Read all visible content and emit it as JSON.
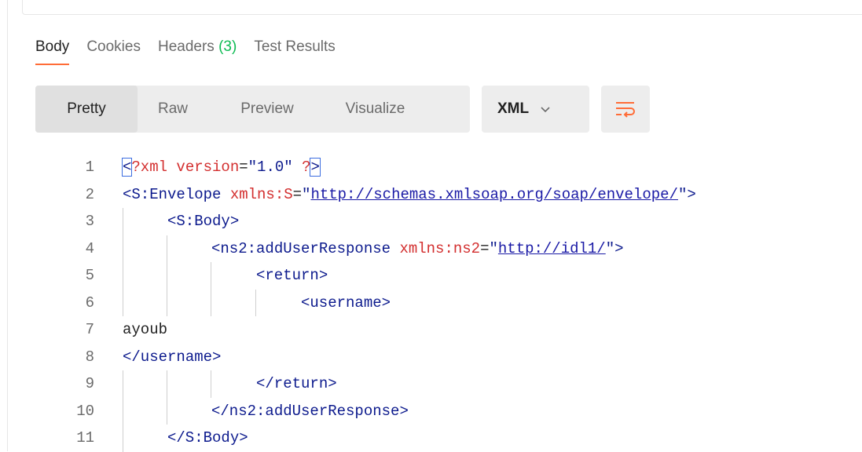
{
  "tabs": [
    {
      "label": "Body",
      "count": ""
    },
    {
      "label": "Cookies",
      "count": ""
    },
    {
      "label": "Headers",
      "count": "(3)"
    },
    {
      "label": "Test Results",
      "count": ""
    }
  ],
  "view_modes": [
    "Pretty",
    "Raw",
    "Preview",
    "Visualize"
  ],
  "format": {
    "selected": "XML",
    "icon": "chevron-down-icon"
  },
  "wrap_icon": "wrap-lines-icon",
  "accent_color": "#ff6c37",
  "code_lines": [
    {
      "n": "1",
      "segments": [
        [
          "hl",
          "<"
        ],
        [
          "attr",
          "?xml"
        ],
        [
          "attr",
          " version"
        ],
        [
          "plain",
          "="
        ],
        [
          "val",
          "\"1.0\""
        ],
        [
          "plain",
          " "
        ],
        [
          "attr",
          "?"
        ],
        [
          "hl",
          ">"
        ]
      ]
    },
    {
      "n": "2",
      "segments": [
        [
          "tag",
          "<S:Envelope"
        ],
        [
          "attr",
          " xmlns:S"
        ],
        [
          "plain",
          "="
        ],
        [
          "val",
          "\""
        ],
        [
          "link",
          "http://schemas.xmlsoap.org/soap/envelope/"
        ],
        [
          "val",
          "\""
        ],
        [
          "tag",
          ">"
        ]
      ]
    },
    {
      "n": "3",
      "segments": [
        [
          "tag",
          "<S:Body>"
        ]
      ]
    },
    {
      "n": "4",
      "segments": [
        [
          "tag",
          "<ns2:addUserResponse"
        ],
        [
          "attr",
          " xmlns:ns2"
        ],
        [
          "plain",
          "="
        ],
        [
          "val",
          "\""
        ],
        [
          "link",
          "http://idl1/"
        ],
        [
          "val",
          "\""
        ],
        [
          "tag",
          ">"
        ]
      ]
    },
    {
      "n": "5",
      "segments": [
        [
          "tag",
          "<return>"
        ]
      ]
    },
    {
      "n": "6",
      "segments": [
        [
          "tag",
          "<username>"
        ]
      ]
    },
    {
      "n": "7",
      "segments": [
        [
          "plain",
          "ayoub"
        ]
      ]
    },
    {
      "n": "8",
      "segments": [
        [
          "tag",
          "</username>"
        ]
      ]
    },
    {
      "n": "9",
      "segments": [
        [
          "tag",
          "</return>"
        ]
      ]
    },
    {
      "n": "10",
      "segments": [
        [
          "tag",
          "</ns2:addUserResponse>"
        ]
      ]
    },
    {
      "n": "11",
      "segments": [
        [
          "tag",
          "</S:Body>"
        ]
      ]
    }
  ]
}
